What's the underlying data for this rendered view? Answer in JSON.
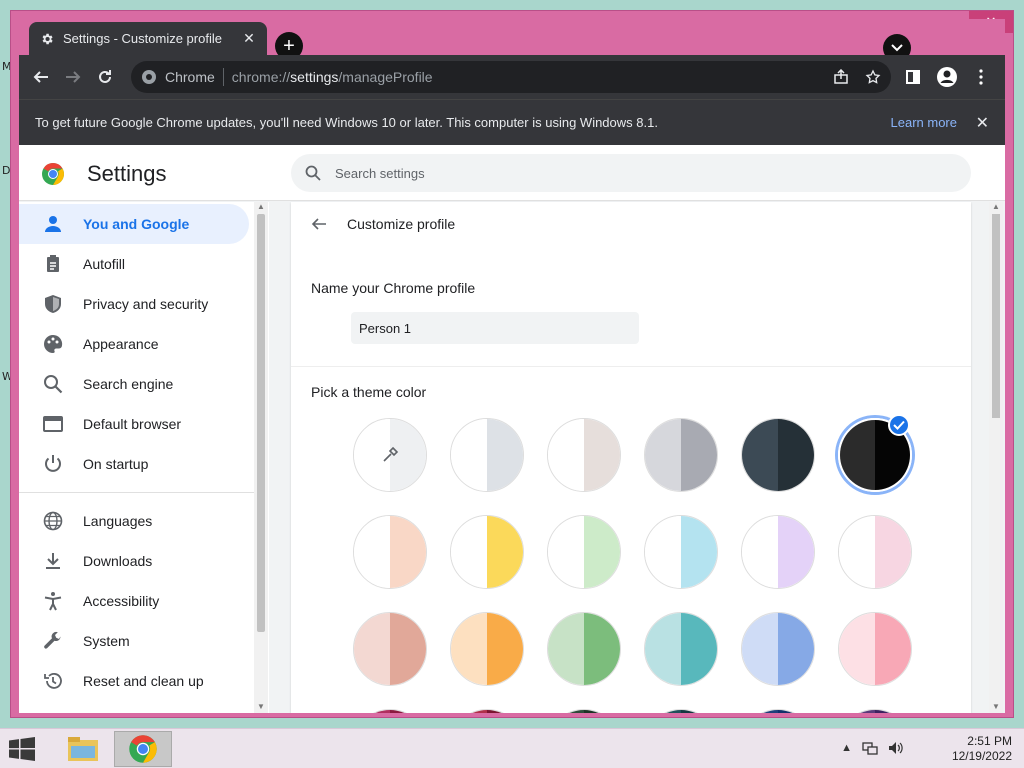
{
  "desktop": {
    "labels": [
      "M",
      "D",
      "W"
    ]
  },
  "window": {
    "controls": [
      "–",
      "□",
      "✕"
    ]
  },
  "tab": {
    "title": "Settings - Customize profile",
    "close": "✕"
  },
  "toolbar": {
    "site_label": "Chrome",
    "url_scheme": "chrome://",
    "url_host": "settings",
    "url_path": "/manageProfile"
  },
  "infobar": {
    "message": "To get future Google Chrome updates, you'll need Windows 10 or later. This computer is using Windows 8.1.",
    "learn_more": "Learn more",
    "close": "✕"
  },
  "settings": {
    "title": "Settings",
    "search_placeholder": "Search settings",
    "nav": [
      {
        "label": "You and Google",
        "icon": "person-icon",
        "active": true
      },
      {
        "label": "Autofill",
        "icon": "clipboard-icon"
      },
      {
        "label": "Privacy and security",
        "icon": "shield-icon"
      },
      {
        "label": "Appearance",
        "icon": "palette-icon"
      },
      {
        "label": "Search engine",
        "icon": "search-icon"
      },
      {
        "label": "Default browser",
        "icon": "browser-icon"
      },
      {
        "label": "On startup",
        "icon": "power-icon"
      },
      {
        "label": "Languages",
        "icon": "globe-icon"
      },
      {
        "label": "Downloads",
        "icon": "download-icon"
      },
      {
        "label": "Accessibility",
        "icon": "accessibility-icon"
      },
      {
        "label": "System",
        "icon": "wrench-icon"
      },
      {
        "label": "Reset and clean up",
        "icon": "history-icon"
      }
    ]
  },
  "profile": {
    "subpage_title": "Customize profile",
    "name_label": "Name your Chrome profile",
    "name_value": "Person 1",
    "theme_label": "Pick a theme color",
    "selected_theme_index": 5,
    "themes": [
      {
        "left": "#ffffff",
        "right": "#eef0f2",
        "picker": true
      },
      {
        "left": "#ffffff",
        "right": "#dde1e6"
      },
      {
        "left": "#ffffff",
        "right": "#e6dedb"
      },
      {
        "left": "#d6d7dc",
        "right": "#a8aab2"
      },
      {
        "left": "#3c4a55",
        "right": "#253037"
      },
      {
        "left": "#2b2b2b",
        "right": "#050505"
      },
      {
        "left": "#ffffff",
        "right": "#f9d7c6"
      },
      {
        "left": "#ffffff",
        "right": "#fbd95a"
      },
      {
        "left": "#ffffff",
        "right": "#cdebc9"
      },
      {
        "left": "#ffffff",
        "right": "#b4e3f0"
      },
      {
        "left": "#ffffff",
        "right": "#e4d2f8"
      },
      {
        "left": "#ffffff",
        "right": "#f7d6e2"
      },
      {
        "left": "#f3d8d2",
        "right": "#e1a899"
      },
      {
        "left": "#fde0c0",
        "right": "#f9ab48"
      },
      {
        "left": "#c7e2c6",
        "right": "#7cbd7c"
      },
      {
        "left": "#b9e1e3",
        "right": "#58b8bc"
      },
      {
        "left": "#cfdcf6",
        "right": "#86a9e6"
      },
      {
        "left": "#fde0e5",
        "right": "#f8a8b6"
      },
      {
        "left": "#b03060",
        "right": "#8a1a3f"
      },
      {
        "left": "#b0304a",
        "right": "#7a1530"
      },
      {
        "left": "#2e4a3a",
        "right": "#1d3326"
      },
      {
        "left": "#20505a",
        "right": "#123840"
      },
      {
        "left": "#1f3f7a",
        "right": "#12306a"
      },
      {
        "left": "#5a3a7a",
        "right": "#3d2360"
      }
    ]
  },
  "taskbar": {
    "time": "2:51 PM",
    "date": "12/19/2022"
  }
}
